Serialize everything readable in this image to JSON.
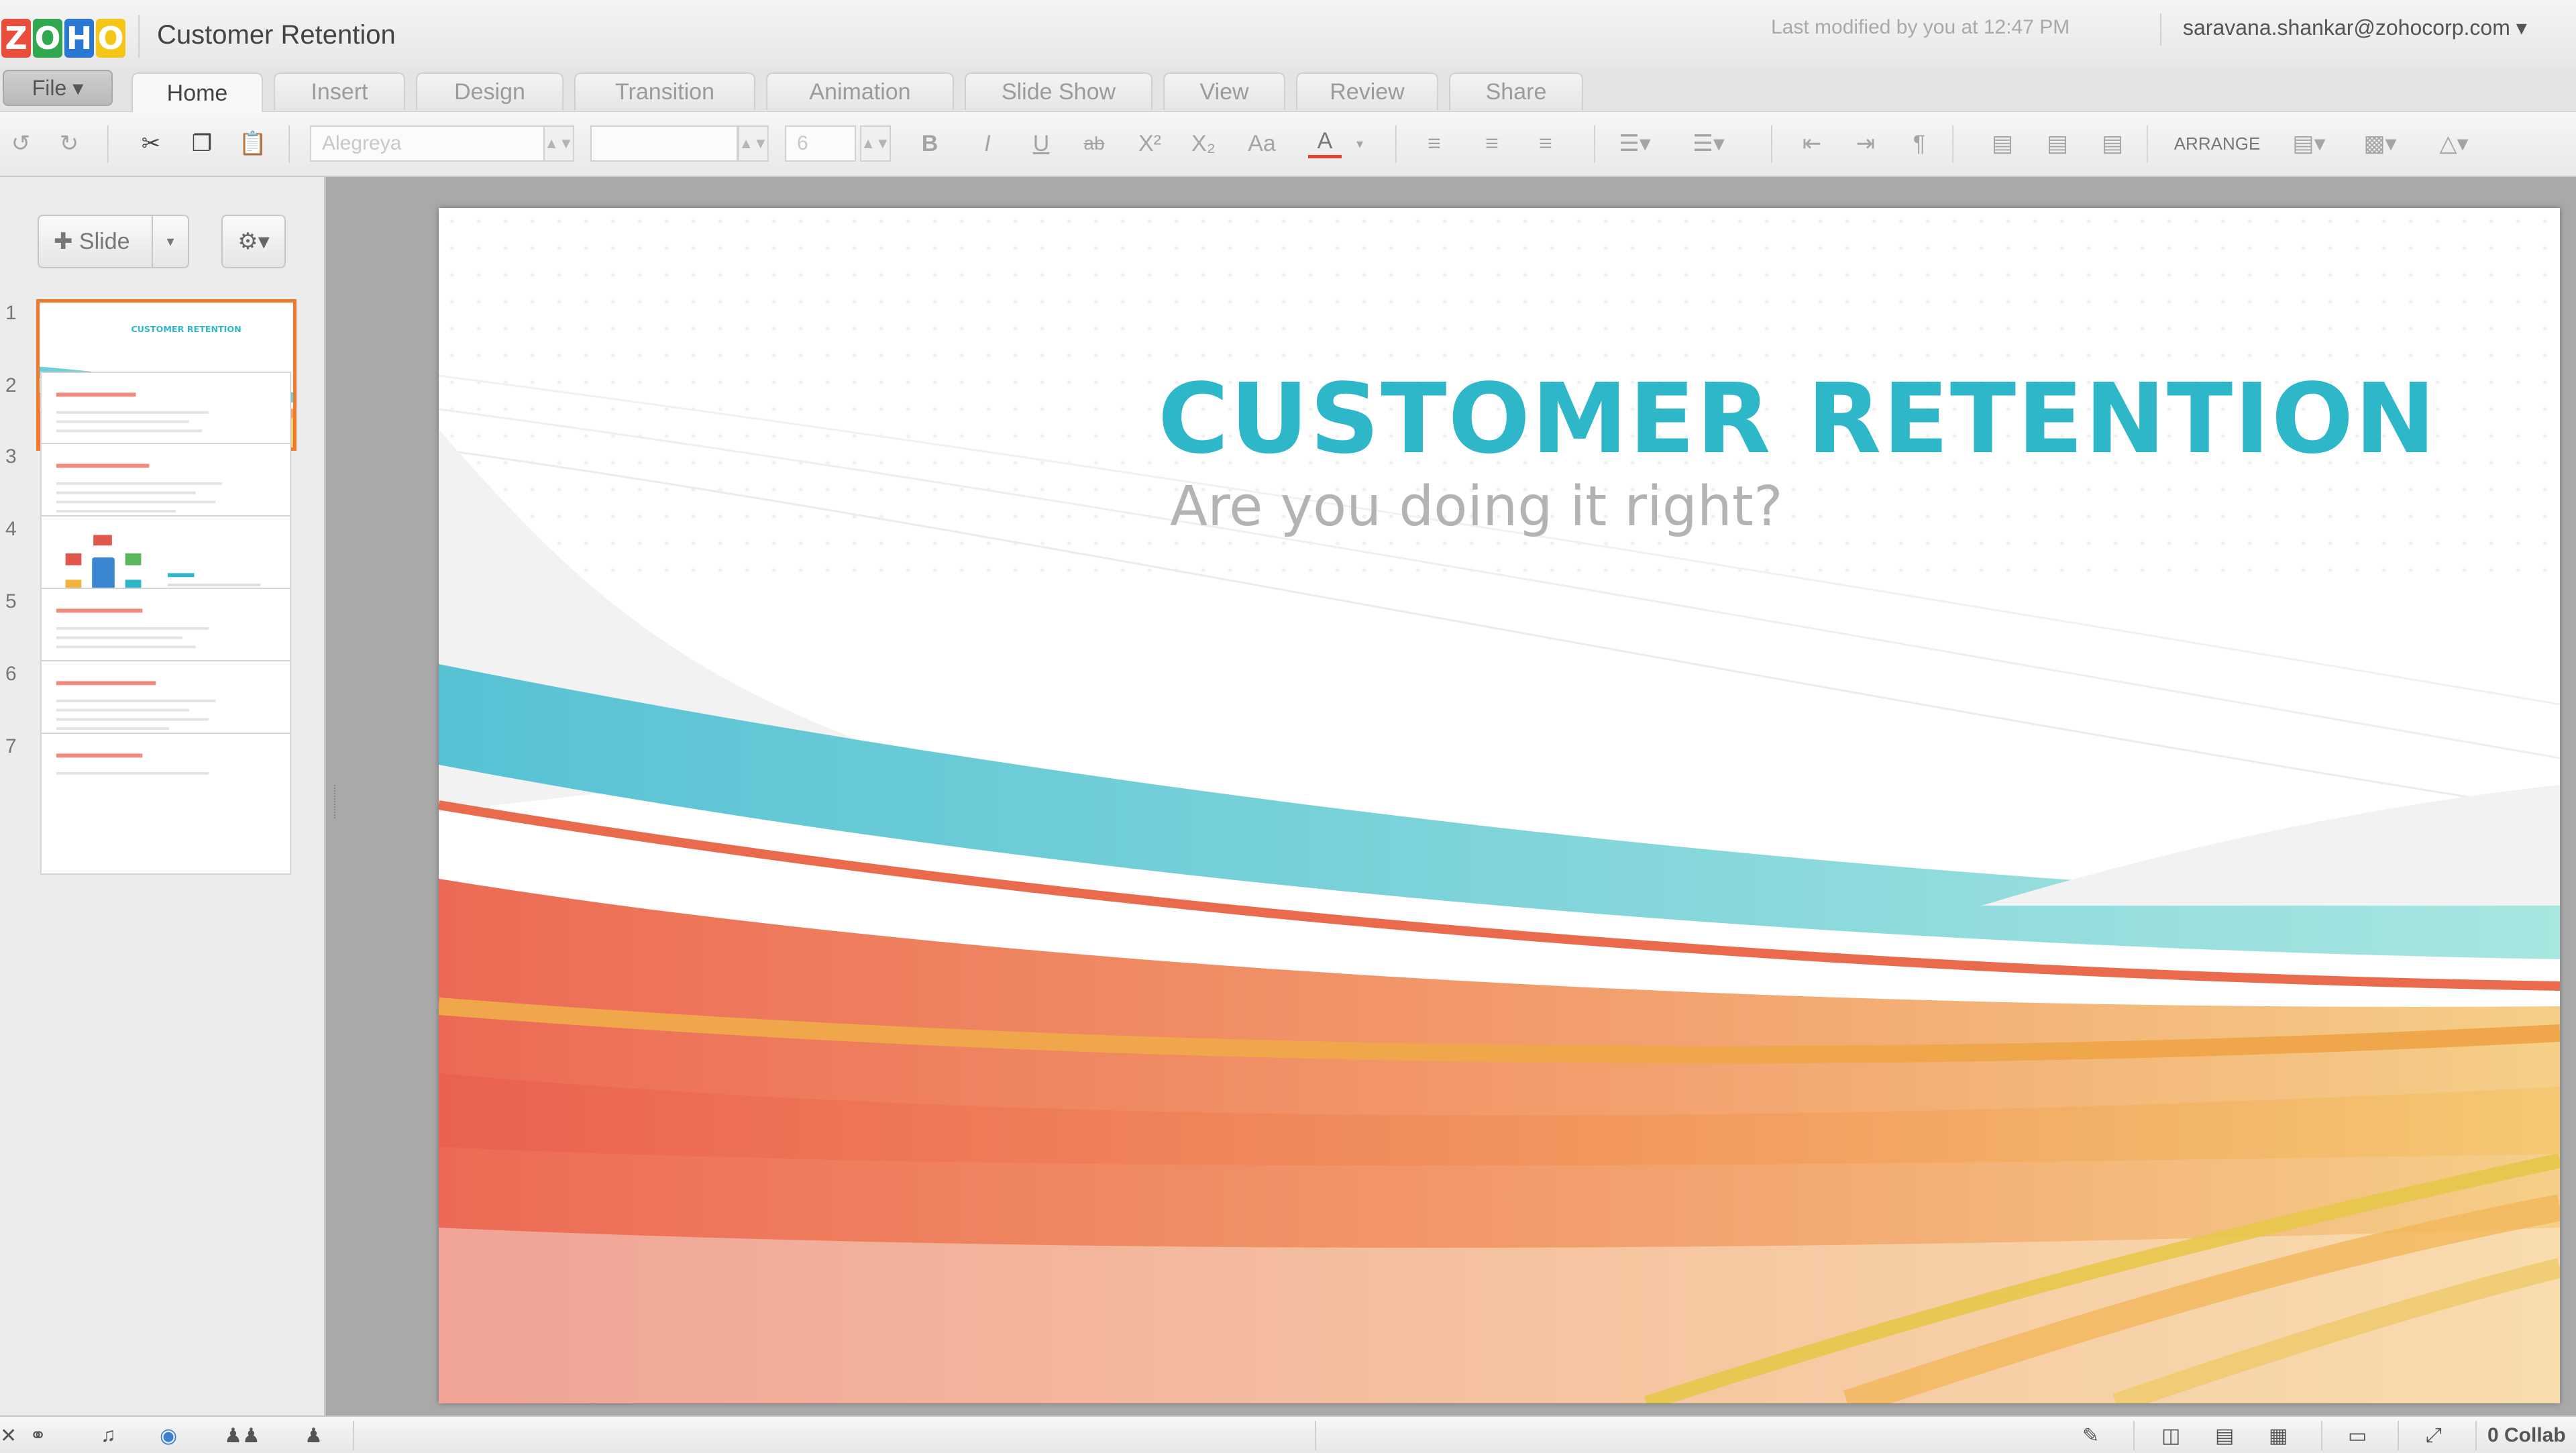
{
  "app": {
    "logo_letters": [
      "Z",
      "O",
      "H",
      "O"
    ],
    "logo_colors": [
      "#e94e3c",
      "#2fa84f",
      "#2b78d4",
      "#f5c518"
    ],
    "document_title": "Customer Retention",
    "last_modified": "Last modified by you at 12:47 PM",
    "user_email": "saravana.shankar@zohocorp.com ▾"
  },
  "menu": {
    "file_label": "File ▾",
    "tabs": [
      "Home",
      "Insert",
      "Design",
      "Transition",
      "Animation",
      "Slide Show",
      "View",
      "Review",
      "Share"
    ],
    "active_tab": "Home"
  },
  "toolbar": {
    "font_family": "Alegreya",
    "font_size": "6",
    "bold": "B",
    "italic": "I",
    "underline": "U",
    "strike": "ab",
    "superscript": "X²",
    "subscript": "X₂",
    "change_case": "Aa",
    "font_color": "A",
    "arrange_label": "ARRANGE"
  },
  "slide_panel": {
    "add_slide_label": "✚ Slide",
    "slide_numbers": [
      "1",
      "2",
      "3",
      "4",
      "5",
      "6",
      "7"
    ],
    "selected_slide": 1,
    "accent_color": "#f07a2a"
  },
  "slide": {
    "title": "CUSTOMER RETENTION",
    "subtitle": "Are you doing it right?",
    "title_color": "#2db7c8"
  },
  "statusbar": {
    "collaborators": "0 Collab"
  }
}
